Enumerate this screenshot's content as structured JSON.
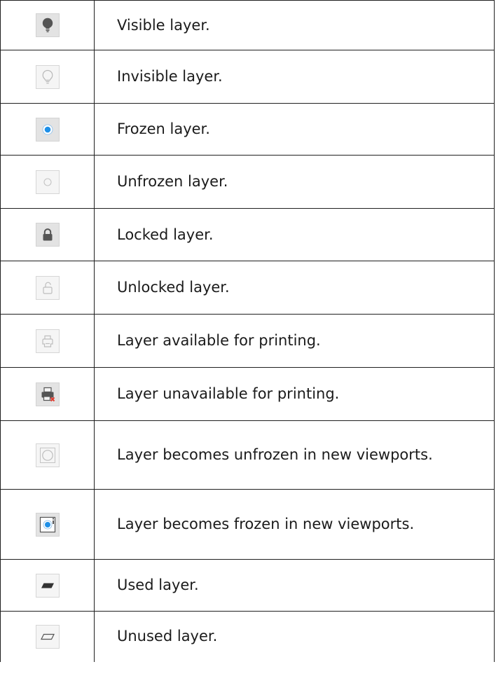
{
  "rows": [
    {
      "icon": "lightbulb-on-icon",
      "description": "Visible layer."
    },
    {
      "icon": "lightbulb-off-icon",
      "description": "Invisible layer."
    },
    {
      "icon": "frozen-radio-icon",
      "description": "Frozen layer."
    },
    {
      "icon": "unfrozen-circle-icon",
      "description": "Unfrozen layer."
    },
    {
      "icon": "lock-closed-icon",
      "description": "Locked layer."
    },
    {
      "icon": "lock-open-icon",
      "description": "Unlocked layer."
    },
    {
      "icon": "printer-icon",
      "description": "Layer available for printing."
    },
    {
      "icon": "printer-disabled-icon",
      "description": "Layer unavailable for printing."
    },
    {
      "icon": "new-viewport-unfrozen-icon",
      "description": "Layer becomes unfrozen in new viewports."
    },
    {
      "icon": "new-viewport-frozen-icon",
      "description": "Layer becomes frozen in new viewports."
    },
    {
      "icon": "used-layer-icon",
      "description": "Used layer."
    },
    {
      "icon": "unused-layer-icon",
      "description": "Unused layer."
    }
  ],
  "colors": {
    "frozen_blue": "#1e90e8",
    "unavailable_red": "#e03a2e"
  }
}
